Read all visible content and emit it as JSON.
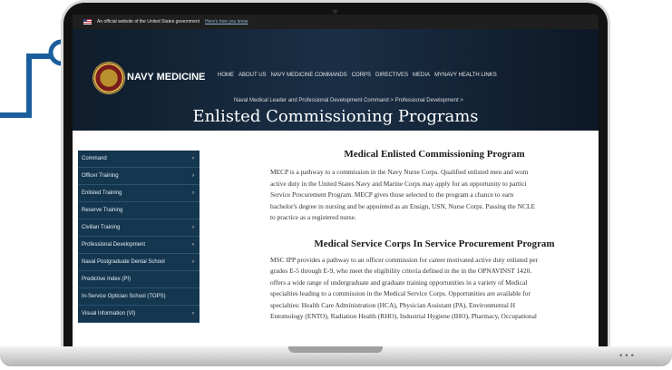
{
  "gov_banner": {
    "text": "An official website of the United States government",
    "link": "Here's how you know"
  },
  "site": {
    "logo_text": "NAVY MEDICINE"
  },
  "top_nav": [
    "HOME",
    "ABOUT US",
    "NAVY MEDICINE COMMANDS",
    "CORPS",
    "DIRECTIVES",
    "MEDIA",
    "MYNAVY HEALTH LINKS"
  ],
  "breadcrumb": "Naval Medical Leader and Professional Development Command > Professional Development >",
  "page_title": "Enlisted Commissioning Programs",
  "sidebar": {
    "items": [
      {
        "label": "Command",
        "has_children": true
      },
      {
        "label": "Officer Training",
        "has_children": true
      },
      {
        "label": "Enlisted Training",
        "has_children": true
      },
      {
        "label": "Reserve Training",
        "has_children": false
      },
      {
        "label": "Civilian Training",
        "has_children": true
      },
      {
        "label": "Professional Development",
        "has_children": true
      },
      {
        "label": "Naval Postgraduate Dental School",
        "has_children": true
      },
      {
        "label": "Predictive Index (PI)",
        "has_children": false
      },
      {
        "label": "In-Service Optician School (TOPS)",
        "has_children": false
      },
      {
        "label": "Visual Information (VI)",
        "has_children": true
      }
    ],
    "chevron_glyph": "›"
  },
  "sections": [
    {
      "heading": "Medical Enlisted Commissioning Program",
      "lines": [
        "MECP is a pathway to a commission in the Navy Nurse Corps. Qualified enlisted men and wom",
        "active duty in the United States Navy and Marine Corps may apply for an opportunity to partici",
        "Service Procurement Program. MECP gives those selected to the program a chance to earn",
        "bachelor's degree in nursing and be appointed as an Ensign, USN, Nurse Corps. Passing the NCLE",
        "to practice as a registered nurse."
      ]
    },
    {
      "heading": "Medical Service Corps In Service Procurement Program",
      "lines": [
        "MSC IPP provides a pathway to an officer commission for career motivated active duty enlisted per",
        "grades E-5 through E-9, who meet the eligibility criteria defined in the in the OPNAVINST 1420.",
        "offers a wide range of undergraduate and graduate training opportunities in a variety of Medical",
        "specialties leading to a commission in the Medical Service Corps. Opportunities are available for",
        "specialties: Health Care Administration (HCA), Physician Assistant (PA), Environmental H",
        "Entomology (ENTO), Radiation Health (RHO), Industrial Hygiene (IHO), Pharmacy, Occupational"
      ]
    }
  ],
  "colors": {
    "sidebar_bg": "#14364f",
    "header_bg": "#1a2f46",
    "connector": "#1b5e9e"
  },
  "decor": {
    "base_dots": "•••"
  }
}
